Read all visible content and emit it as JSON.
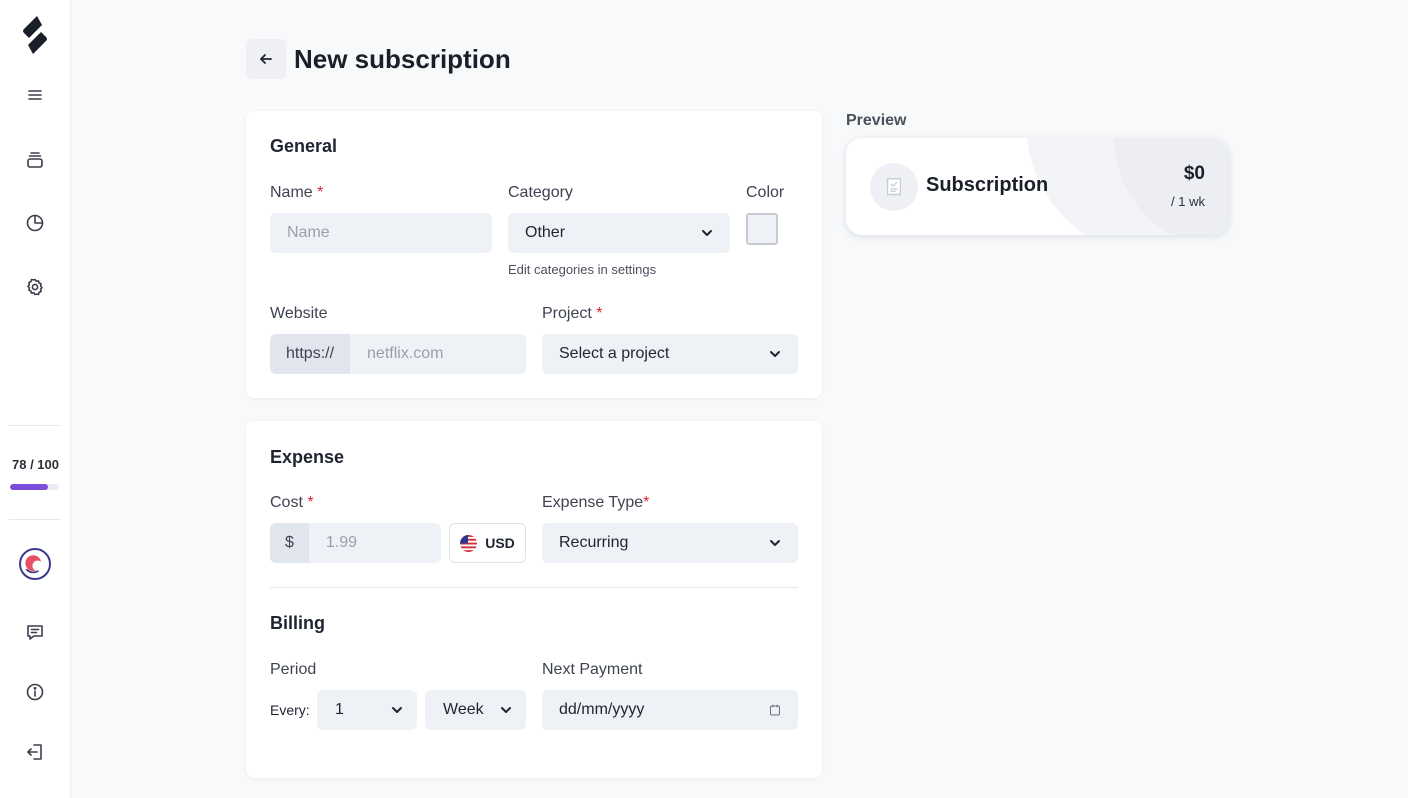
{
  "sidebar": {
    "items": [
      {
        "name": "menu",
        "icon": "hamburger-menu-icon"
      },
      {
        "name": "subscriptions",
        "icon": "stack-icon"
      },
      {
        "name": "statistics",
        "icon": "pie-chart-icon"
      },
      {
        "name": "settings",
        "icon": "gear-icon"
      },
      {
        "name": "feedback",
        "icon": "message-icon"
      },
      {
        "name": "about",
        "icon": "info-icon"
      },
      {
        "name": "logout",
        "icon": "logout-icon"
      }
    ],
    "usage": {
      "label": "78 / 100",
      "fraction": 0.78
    },
    "accent_color": "#7c4ddb"
  },
  "header": {
    "back_icon": "arrow-left-icon",
    "title": "New subscription"
  },
  "general": {
    "title": "General",
    "name_label": "Name",
    "name_placeholder": "Name",
    "category_label": "Category",
    "category_value": "Other",
    "category_hint": "Edit categories in settings",
    "color_label": "Color",
    "website_label": "Website",
    "website_prefix": "https://",
    "website_placeholder": "netflix.com",
    "project_label": "Project",
    "project_value": "Select a project",
    "required_marker": "*"
  },
  "expense": {
    "title": "Expense",
    "cost_label": "Cost",
    "cost_prefix": "$",
    "cost_placeholder": "1.99",
    "currency": "USD",
    "expense_type_label": "Expense Type",
    "expense_type_value": "Recurring"
  },
  "billing": {
    "title": "Billing",
    "period_label": "Period",
    "every_label": "Every:",
    "period_count": "1",
    "period_unit": "Week",
    "next_payment_label": "Next Payment",
    "next_payment_placeholder": "dd/mm/yyyy"
  },
  "preview": {
    "label": "Preview",
    "name": "Subscription",
    "price": "$0",
    "period": "/ 1 wk"
  }
}
